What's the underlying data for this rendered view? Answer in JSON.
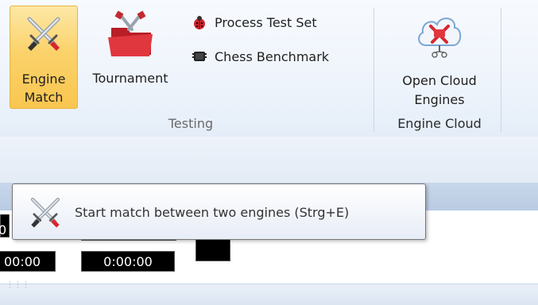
{
  "ribbon": {
    "testing_group": {
      "label": "Testing",
      "engine_match": {
        "line1": "Engine",
        "line2": "Match",
        "icon": "crossed-swords-icon",
        "active": true
      },
      "tournament": {
        "label": "Tournament",
        "icon": "tournament-folder-icon"
      },
      "process_test_set": {
        "label": "Process Test Set",
        "icon": "ladybug-icon"
      },
      "chess_benchmark": {
        "label": "Chess Benchmark",
        "icon": "chip-icon"
      }
    },
    "engine_cloud_group": {
      "label": "Engine Cloud",
      "open_cloud_engines": {
        "line1": "Open Cloud",
        "line2": "Engines",
        "icon": "cloud-engine-icon"
      }
    }
  },
  "clocks": {
    "left_clock": "00:00",
    "right_clock": "0:00:00",
    "left_top_fragment": "0"
  },
  "tooltip": {
    "text": "Start match between two engines (Strg+E)",
    "icon": "crossed-swords-icon"
  },
  "colors": {
    "ribbon_bg": "#edf3fb",
    "active_button": "#fbd26a",
    "clock_bg": "#000000",
    "icon_red": "#d7262e"
  }
}
